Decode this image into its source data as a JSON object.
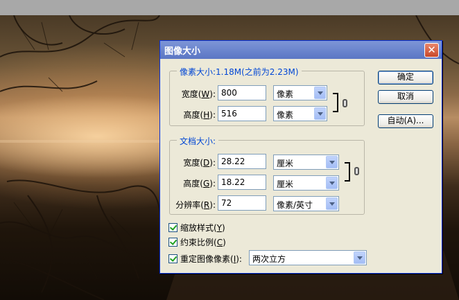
{
  "dialog": {
    "title": "图像大小",
    "close_glyph": "✕"
  },
  "pixel_dimensions": {
    "legend": "像素大小:1.18M(之前为2.23M)",
    "width": {
      "label": "宽度",
      "mnemonic": "W",
      "value": "800",
      "unit": "像素"
    },
    "height": {
      "label": "高度",
      "mnemonic": "H",
      "value": "516",
      "unit": "像素"
    }
  },
  "document_size": {
    "legend": "文档大小:",
    "width": {
      "label": "宽度",
      "mnemonic": "D",
      "value": "28.22",
      "unit": "厘米"
    },
    "height": {
      "label": "高度",
      "mnemonic": "G",
      "value": "18.22",
      "unit": "厘米"
    },
    "resolution": {
      "label": "分辨率",
      "mnemonic": "R",
      "value": "72",
      "unit": "像素/英寸"
    }
  },
  "buttons": {
    "ok": "确定",
    "cancel": "取消",
    "auto": "自动(A)..."
  },
  "options": {
    "scale_styles": {
      "label": "缩放样式",
      "mnemonic": "Y",
      "checked": true
    },
    "constrain": {
      "label": "约束比例",
      "mnemonic": "C",
      "checked": true
    },
    "resample": {
      "label": "重定图像像素",
      "mnemonic": "I",
      "checked": true,
      "method": "两次立方"
    }
  }
}
